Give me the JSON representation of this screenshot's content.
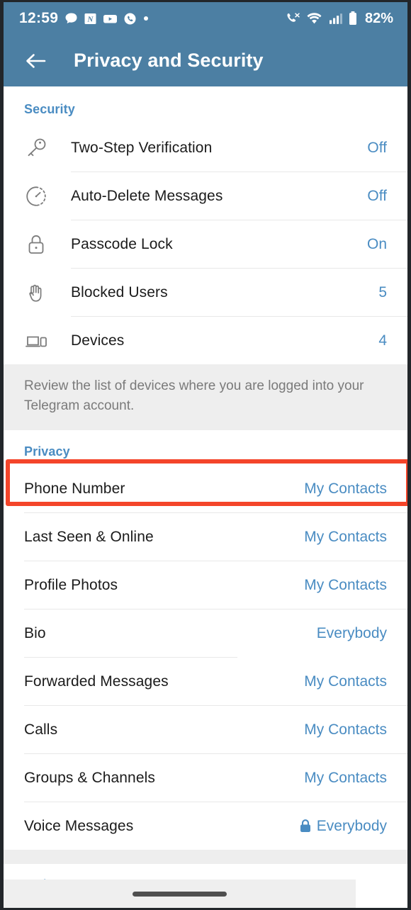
{
  "status_bar": {
    "time": "12:59",
    "battery_percent": "82%",
    "left_icons": [
      "chat-bubble-icon",
      "news-app-icon",
      "youtube-icon",
      "whatsapp-icon",
      "dot-icon"
    ],
    "right_icons": [
      "call-mute-icon",
      "wifi-icon",
      "cellular-signal-icon",
      "battery-icon"
    ]
  },
  "appbar": {
    "back_label": "back-arrow",
    "title": "Privacy and Security"
  },
  "colors": {
    "header_bg": "#4c7fa3",
    "accent_blue": "#4a8cc2",
    "highlight_red": "#f4452a",
    "note_bg": "#eeeeee",
    "icon_grey": "#7c7c7c"
  },
  "security": {
    "header": "Security",
    "rows": [
      {
        "icon": "key-icon",
        "label": "Two-Step Verification",
        "value": "Off"
      },
      {
        "icon": "auto-delete-timer-icon",
        "label": "Auto-Delete Messages",
        "value": "Off"
      },
      {
        "icon": "padlock-icon",
        "label": "Passcode Lock",
        "value": "On"
      },
      {
        "icon": "hand-icon",
        "label": "Blocked Users",
        "value": "5"
      },
      {
        "icon": "devices-icon",
        "label": "Devices",
        "value": "4"
      }
    ],
    "note": "Review the list of devices where you are logged into your Telegram account."
  },
  "privacy": {
    "header": "Privacy",
    "rows": [
      {
        "label": "Phone Number",
        "value": "My Contacts",
        "highlighted": true,
        "lock": false
      },
      {
        "label": "Last Seen & Online",
        "value": "My Contacts",
        "highlighted": false,
        "lock": false
      },
      {
        "label": "Profile Photos",
        "value": "My Contacts",
        "highlighted": false,
        "lock": false
      },
      {
        "label": "Bio",
        "value": "Everybody",
        "highlighted": false,
        "lock": false
      },
      {
        "label": "Forwarded Messages",
        "value": "My Contacts",
        "highlighted": false,
        "lock": false
      },
      {
        "label": "Calls",
        "value": "My Contacts",
        "highlighted": false,
        "lock": false
      },
      {
        "label": "Groups & Channels",
        "value": "My Contacts",
        "highlighted": false,
        "lock": false
      },
      {
        "label": "Voice Messages",
        "value": "Everybody",
        "highlighted": false,
        "lock": true
      }
    ]
  },
  "footer": {
    "delete_account": "Delete my account"
  }
}
